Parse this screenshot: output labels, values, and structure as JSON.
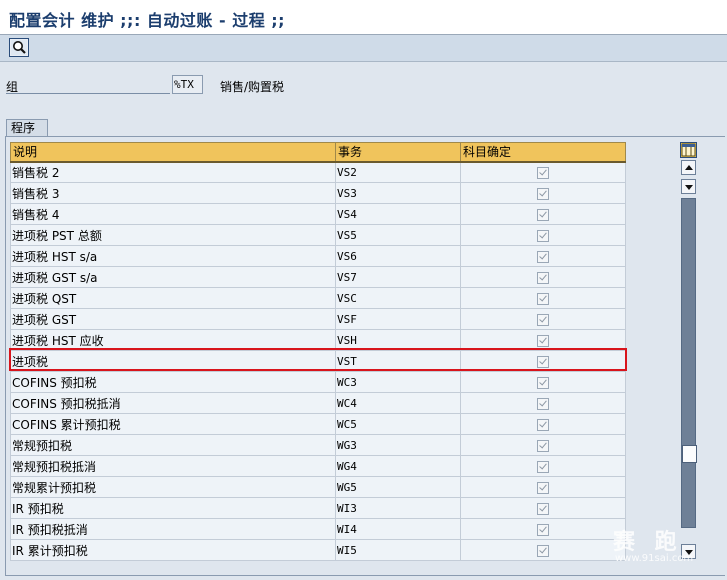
{
  "window": {
    "title": "配置会计 维护 ;;: 自动过账 - 过程 ;;"
  },
  "toolbar": {
    "search_icon": "magnifier-icon"
  },
  "group": {
    "label": "组",
    "value": "%TX",
    "description": "销售/购置税"
  },
  "section": {
    "title": "程序"
  },
  "table": {
    "headers": [
      "说明",
      "事务",
      "科目确定"
    ],
    "rows": [
      {
        "desc": "销售税 2",
        "code": "VS2",
        "checked": true
      },
      {
        "desc": "销售税 3",
        "code": "VS3",
        "checked": true
      },
      {
        "desc": "销售税 4",
        "code": "VS4",
        "checked": true
      },
      {
        "desc": "进项税 PST 总额",
        "code": "VS5",
        "checked": true
      },
      {
        "desc": "进项税 HST s/a",
        "code": "VS6",
        "checked": true
      },
      {
        "desc": "进项税 GST s/a",
        "code": "VS7",
        "checked": true
      },
      {
        "desc": "进项税 QST",
        "code": "VSC",
        "checked": true
      },
      {
        "desc": "进项税 GST",
        "code": "VSF",
        "checked": true
      },
      {
        "desc": "进项税 HST 应收",
        "code": "VSH",
        "checked": true
      },
      {
        "desc": "进项税",
        "code": "VST",
        "checked": true
      },
      {
        "desc": "COFINS 预扣税",
        "code": "WC3",
        "checked": true
      },
      {
        "desc": "COFINS 预扣税抵消",
        "code": "WC4",
        "checked": true
      },
      {
        "desc": "COFINS 累计预扣税",
        "code": "WC5",
        "checked": true
      },
      {
        "desc": "常规预扣税",
        "code": "WG3",
        "checked": true
      },
      {
        "desc": "常规预扣税抵消",
        "code": "WG4",
        "checked": true
      },
      {
        "desc": "常规累计预扣税",
        "code": "WG5",
        "checked": true
      },
      {
        "desc": "IR 预扣税",
        "code": "WI3",
        "checked": true
      },
      {
        "desc": "IR 预扣税抵消",
        "code": "WI4",
        "checked": true
      },
      {
        "desc": "IR 累计预扣税",
        "code": "WI5",
        "checked": true
      }
    ]
  },
  "highlight_color": "#d8141c",
  "header_color": "#f0c45c",
  "watermark": {
    "main": "赛 跑",
    "sub": "www.91sai.com"
  }
}
